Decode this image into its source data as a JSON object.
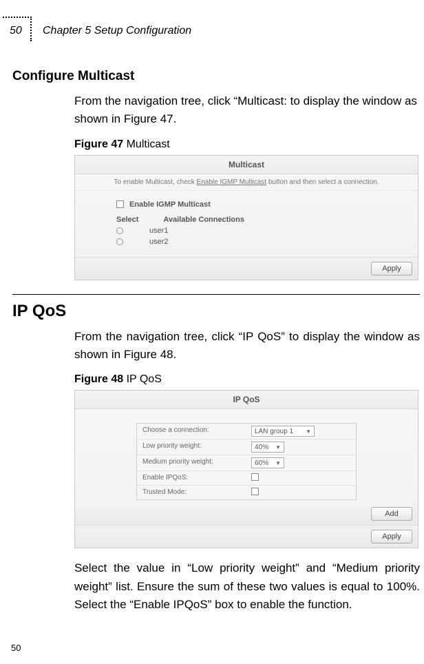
{
  "header": {
    "page_number": "50",
    "chapter_title": "Chapter 5 Setup Configuration"
  },
  "section1": {
    "title": "Configure Multicast",
    "para1": "From the navigation tree, click “Multicast: to display the window as shown in Figure 47.",
    "fig_label_bold": "Figure 47",
    "fig_label_rest": " Multicast"
  },
  "fig47": {
    "title": "Multicast",
    "hint_prefix": "To enable Multicast, check ",
    "hint_underline": "Enable IGMP Multicast",
    "hint_suffix": " button and then select a connection.",
    "checkbox_label": "Enable IGMP Multicast",
    "col_select": "Select",
    "col_conn": "Available Connections",
    "rows": [
      "user1",
      "user2"
    ],
    "apply": "Apply"
  },
  "section2": {
    "title": "IP QoS",
    "para1": "From the navigation tree, click “IP QoS” to display the window as shown in Figure 48.",
    "fig_label_bold": "Figure 48",
    "fig_label_rest": " IP QoS"
  },
  "fig48": {
    "title": "IP QoS",
    "rows": {
      "choose_label": "Choose a connection:",
      "choose_val": "LAN group 1",
      "low_label": "Low priority weight:",
      "low_val": "40%",
      "med_label": "Medium priority weight:",
      "med_val": "60%",
      "enable_label": "Enable IPQoS:",
      "trusted_label": "Trusted Mode:"
    },
    "add": "Add",
    "apply": "Apply"
  },
  "para_after": "Select the value in “Low priority weight” and “Medium priority weight” list. Ensure the sum of these two values is equal to 100%. Select the “Enable IPQoS” box to enable the function.",
  "footer_page": "50"
}
